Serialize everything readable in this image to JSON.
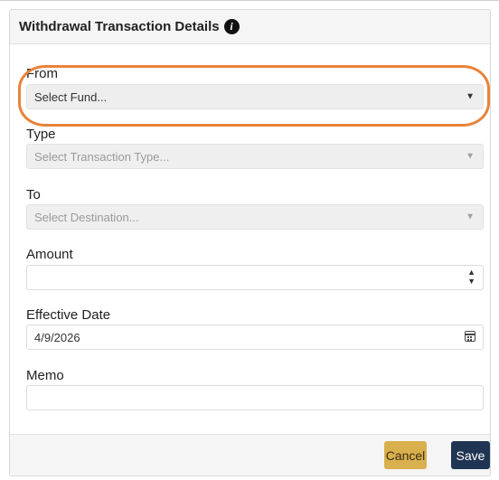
{
  "panel": {
    "title": "Withdrawal Transaction Details",
    "info_icon": "info-icon",
    "info_glyph": "i"
  },
  "form": {
    "from": {
      "label": "From",
      "placeholder": "Select Fund...",
      "state": "enabled"
    },
    "type": {
      "label": "Type",
      "placeholder": "Select Transaction Type...",
      "state": "disabled"
    },
    "to": {
      "label": "To",
      "placeholder": "Select Destination...",
      "state": "disabled"
    },
    "amount": {
      "label": "Amount",
      "value": ""
    },
    "effective_date": {
      "label": "Effective Date",
      "value": "4/9/2026"
    },
    "memo": {
      "label": "Memo",
      "value": ""
    }
  },
  "footer": {
    "cancel_label": "Cancel",
    "save_label": "Save"
  },
  "colors": {
    "highlight": "#e8833a",
    "cancel_button": "#d9b04e",
    "save_button": "#1f3553"
  },
  "icons": {
    "caret": "▼",
    "spin_up": "▲",
    "spin_down": "▼"
  }
}
